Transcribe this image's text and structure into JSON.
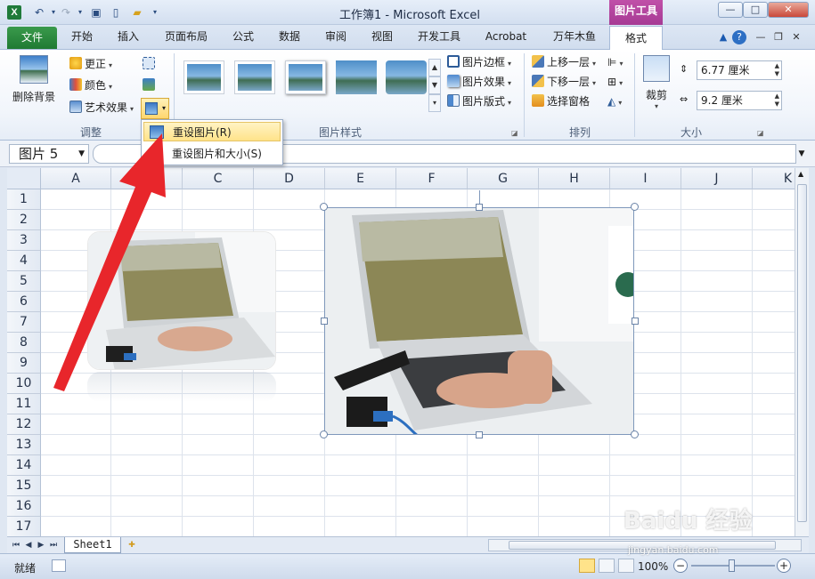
{
  "window": {
    "title": "工作簿1 - Microsoft Excel",
    "context_tab_title": "图片工具"
  },
  "tabs": [
    "文件",
    "开始",
    "插入",
    "页面布局",
    "公式",
    "数据",
    "审阅",
    "视图",
    "开发工具",
    "Acrobat",
    "万年木鱼",
    "格式"
  ],
  "ribbon": {
    "remove_bg": "删除背景",
    "corrections": "更正",
    "color": "颜色",
    "artistic": "艺术效果",
    "group_adjust": "调整",
    "group_styles": "图片样式",
    "picture_border": "图片边框",
    "picture_effects": "图片效果",
    "picture_layout": "图片版式",
    "bring_forward": "上移一层",
    "send_backward": "下移一层",
    "selection_pane": "选择窗格",
    "group_arrange": "排列",
    "crop": "裁剪",
    "height": "6.77 厘米",
    "width": "9.2 厘米",
    "group_size": "大小"
  },
  "menu": {
    "reset_picture": "重设图片(R)",
    "reset_picture_size": "重设图片和大小(S)"
  },
  "formula_bar": {
    "name_box": "图片 5"
  },
  "grid": {
    "columns": [
      "A",
      "B",
      "C",
      "D",
      "E",
      "F",
      "G",
      "H",
      "I",
      "J",
      "K"
    ],
    "rows": [
      "1",
      "2",
      "3",
      "4",
      "5",
      "6",
      "7",
      "8",
      "9",
      "10",
      "11",
      "12",
      "13",
      "14",
      "15",
      "16",
      "17"
    ]
  },
  "sheet": {
    "tab": "Sheet1"
  },
  "status": {
    "ready": "就绪",
    "zoom": "100%"
  },
  "watermark": {
    "text": "Baidu 经验",
    "url": "jingyan.baidu.com"
  }
}
